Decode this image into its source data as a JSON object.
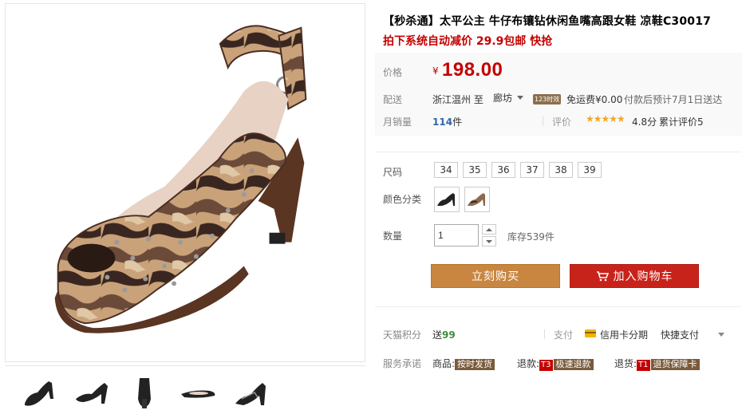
{
  "product": {
    "title": "【秒杀通】太平公主 牛仔布镶钻休闲鱼嘴高跟女鞋 凉鞋C30017",
    "promo": "拍下系统自动减价 29.9包邮 快抢"
  },
  "price": {
    "label": "价格",
    "currency": "¥",
    "value": "198.00"
  },
  "shipping": {
    "label": "配送",
    "from": "浙江温州",
    "to_word": "至",
    "destination": "廊坊",
    "badge": "123时效",
    "fee": "免运费¥0.00",
    "eta": "付款后预计7月1日送达"
  },
  "sales": {
    "label": "月销量",
    "count": "114",
    "unit": "件"
  },
  "rating": {
    "label": "评价",
    "stars": "★★★★★",
    "score": "4.8分",
    "count_text": "累计评价5"
  },
  "options": {
    "size_label": "尺码",
    "sizes": [
      "34",
      "35",
      "36",
      "37",
      "38",
      "39"
    ],
    "color_label": "颜色分类"
  },
  "quantity": {
    "label": "数量",
    "value": "1",
    "stock": "库存539件"
  },
  "actions": {
    "buy_now": "立刻购买",
    "add_to_cart": "加入购物车"
  },
  "points": {
    "label": "天猫积分",
    "prefix": "送",
    "value": "99"
  },
  "payment": {
    "label": "支付",
    "card": "信用卡分期",
    "fast": "快捷支付"
  },
  "service": {
    "label": "服务承诺",
    "goods_label": "商品:",
    "goods_tag": "按时发货",
    "refund_label": "退款:",
    "refund_t": "T3",
    "refund_tag": "极速退款",
    "return_label": "退货:",
    "return_t": "T1",
    "return_tag": "退货保障卡"
  },
  "colors": {
    "price_red": "#c40000",
    "buy_button": "#c98640",
    "cart_button": "#c8231a",
    "link_blue": "#3366aa"
  }
}
